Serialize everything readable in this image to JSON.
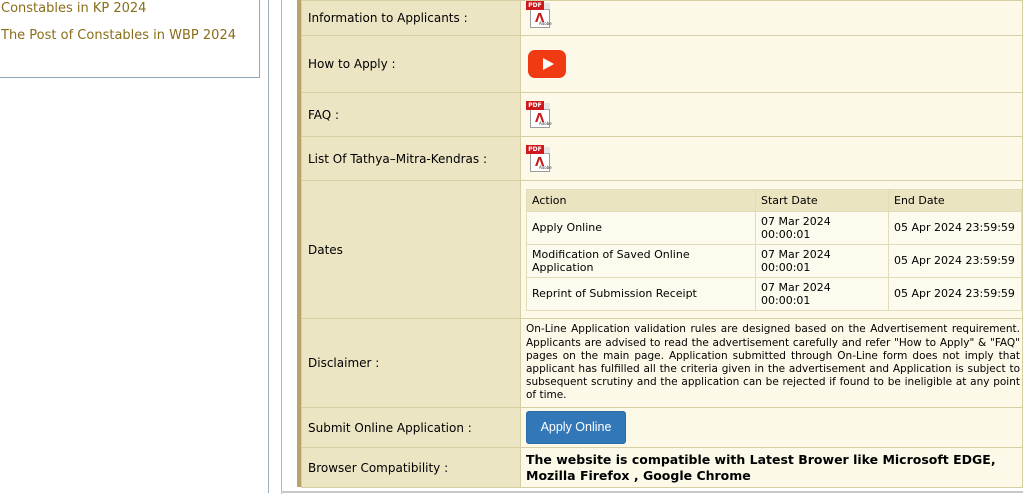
{
  "sidebar": {
    "links": [
      "Constables in KP 2024",
      "The Post of Constables in WBP 2024"
    ]
  },
  "rows": {
    "info_label": "Information to Applicants :",
    "how_label": "How to Apply :",
    "faq_label": "FAQ :",
    "list_label": "List Of Tathya–Mitra-Kendras :",
    "dates_label": "Dates",
    "disclaimer_label": "Disclaimer :",
    "submit_label": "Submit Online Application :",
    "browser_label": "Browser Compatibility :"
  },
  "dates": {
    "headers": [
      "Action",
      "Start Date",
      "End Date"
    ],
    "rows": [
      {
        "action": "Apply Online",
        "start": "07 Mar 2024 00:00:01",
        "end": "05 Apr 2024 23:59:59"
      },
      {
        "action": "Modification of Saved Online Application",
        "start": "07 Mar 2024 00:00:01",
        "end": "05 Apr 2024 23:59:59"
      },
      {
        "action": "Reprint of Submission Receipt",
        "start": "07 Mar 2024 00:00:01",
        "end": "05 Apr 2024 23:59:59"
      }
    ]
  },
  "disclaimer_text": "On-Line Application validation rules are designed based on the Advertisement requirement. Applicants are advised to read the advertisement carefully and refer \"How to Apply\" & \"FAQ\" pages on the main page. Application submitted through On-Line form does not imply that applicant has fulfilled all the criteria given in the advertisement and Application is subject to subsequent scrutiny and the application can be rejected if found to be ineligible at any point of time.",
  "apply_button": "Apply Online",
  "browser_text": "The website is compatible with Latest Brower like Microsoft EDGE, Mozilla Firefox , Google Chrome",
  "icons": {
    "pdf_tag": "PDF",
    "pdf_brand": "Adobe"
  },
  "colors": {
    "label_bg": "#ece5c4",
    "value_bg": "#fcf9e8",
    "button_bg": "#3278b9",
    "youtube_red": "#f03b12",
    "link_color": "#8a6d1a"
  }
}
